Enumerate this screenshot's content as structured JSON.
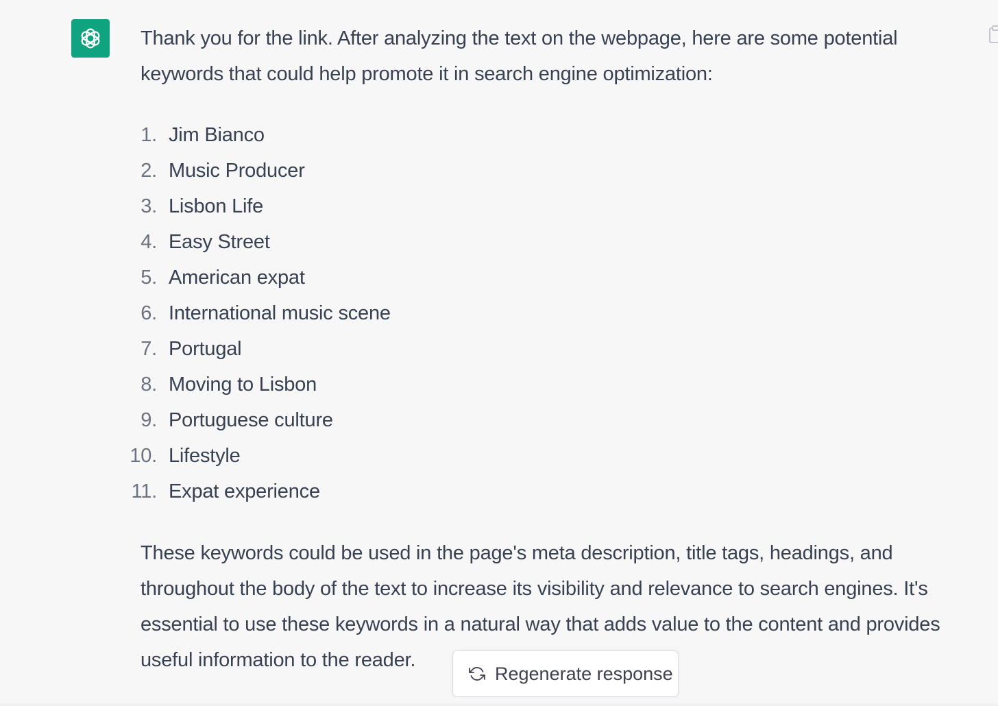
{
  "message": {
    "intro": "Thank you for the link. After analyzing the text on the webpage, here are some potential keywords that could help promote it in search engine optimization:",
    "keywords": [
      {
        "num": "1.",
        "text": "Jim Bianco"
      },
      {
        "num": "2.",
        "text": "Music Producer"
      },
      {
        "num": "3.",
        "text": "Lisbon Life"
      },
      {
        "num": "4.",
        "text": "Easy Street"
      },
      {
        "num": "5.",
        "text": "American expat"
      },
      {
        "num": "6.",
        "text": "International music scene"
      },
      {
        "num": "7.",
        "text": "Portugal"
      },
      {
        "num": "8.",
        "text": "Moving to Lisbon"
      },
      {
        "num": "9.",
        "text": "Portuguese culture"
      },
      {
        "num": "10.",
        "text": "Lifestyle"
      },
      {
        "num": "11.",
        "text": "Expat experience"
      }
    ],
    "outro": "These keywords could be used in the page's meta description, title tags, headings, and throughout the body of the text to increase its visibility and relevance to search engines. It's essential to use these keywords in a natural way that adds value to the content and provides useful information to the reader."
  },
  "regenerate": {
    "label": "Regenerate response",
    "icon": "refresh-icon"
  },
  "icons": {
    "avatar": "openai-logo-icon",
    "copy": "clipboard-icon"
  },
  "colors": {
    "background": "#f7f7f8",
    "avatar": "#10a37f",
    "text": "#374151",
    "list_number": "#6b7280"
  }
}
